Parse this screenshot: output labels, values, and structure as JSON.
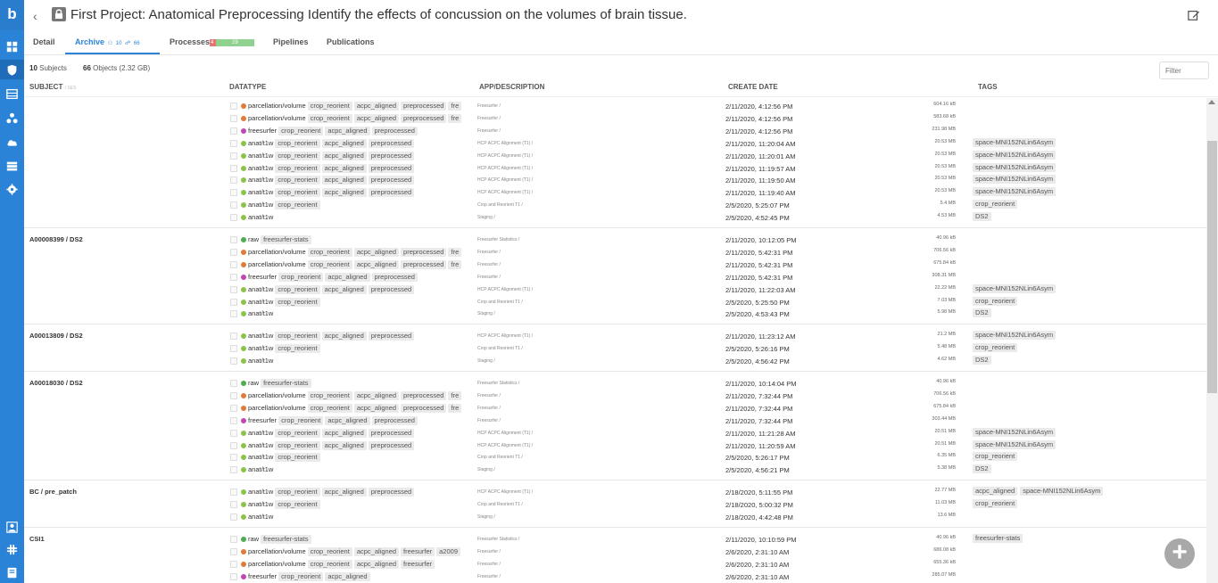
{
  "app": {
    "logo": "b"
  },
  "rail_icons": [
    "dashboard-icon",
    "shield-icon",
    "table-icon",
    "network-icon",
    "cloud-upload-icon",
    "server-icon",
    "gear-icon",
    "user-icon",
    "slack-icon",
    "book-icon"
  ],
  "header": {
    "back": "‹",
    "title": "First Project: Anatomical Preprocessing Identify the effects of concussion on the volumes of brain tissue."
  },
  "tabs": {
    "detail": "Detail",
    "archive": "Archive",
    "archive_users": "10",
    "archive_objects": "66",
    "processes": "Processes",
    "processes_failed": "4",
    "processes_done": "29",
    "pipelines": "Pipelines",
    "publications": "Publications"
  },
  "summary": {
    "subjects_count": "10",
    "subjects_label": "Subjects",
    "objects_count": "66",
    "objects_label": "Objects (2.32 GB)"
  },
  "filter": {
    "placeholder": "Filter"
  },
  "columns": {
    "subject": "SUBJECT",
    "subject_sub": "/ SES",
    "datatype": "DATATYPE",
    "app": "APP/DESCRIPTION",
    "date": "CREATE DATE",
    "tags": "TAGS"
  },
  "colors": {
    "raw": "#4caf50",
    "parcellation": "#e07b39",
    "freesurfer": "#c047b8",
    "anat": "#8bc34a",
    "accent": "#2b83d8"
  },
  "groups": [
    {
      "subject": "",
      "rows": [
        {
          "type": "parcellation/volume",
          "dot": "parcellation",
          "tags": [
            "crop_reorient",
            "acpc_aligned",
            "preprocessed",
            "fre"
          ],
          "app": "Freesurfer /",
          "date": "2/11/2020, 4:12:56 PM",
          "size": "604.16 kB",
          "otags": []
        },
        {
          "type": "parcellation/volume",
          "dot": "parcellation",
          "tags": [
            "crop_reorient",
            "acpc_aligned",
            "preprocessed",
            "fre"
          ],
          "app": "Freesurfer /",
          "date": "2/11/2020, 4:12:56 PM",
          "size": "583.68 kB",
          "otags": []
        },
        {
          "type": "freesurfer",
          "dot": "freesurfer",
          "tags": [
            "crop_reorient",
            "acpc_aligned",
            "preprocessed"
          ],
          "app": "Freesurfer /",
          "date": "2/11/2020, 4:12:56 PM",
          "size": "231.98 MB",
          "otags": []
        },
        {
          "type": "anat/t1w",
          "dot": "anat",
          "tags": [
            "crop_reorient",
            "acpc_aligned",
            "preprocessed"
          ],
          "app": "HCP ACPC Alignment (T1) /",
          "date": "2/11/2020, 11:20:04 AM",
          "size": "20.53 MB",
          "otags": [
            "space-MNI152NLin6Asym"
          ]
        },
        {
          "type": "anat/t1w",
          "dot": "anat",
          "tags": [
            "crop_reorient",
            "acpc_aligned",
            "preprocessed"
          ],
          "app": "HCP ACPC Alignment (T1) /",
          "date": "2/11/2020, 11:20:01 AM",
          "size": "20.53 MB",
          "otags": [
            "space-MNI152NLin6Asym"
          ]
        },
        {
          "type": "anat/t1w",
          "dot": "anat",
          "tags": [
            "crop_reorient",
            "acpc_aligned",
            "preprocessed"
          ],
          "app": "HCP ACPC Alignment (T1) /",
          "date": "2/11/2020, 11:19:57 AM",
          "size": "20.53 MB",
          "otags": [
            "space-MNI152NLin6Asym"
          ]
        },
        {
          "type": "anat/t1w",
          "dot": "anat",
          "tags": [
            "crop_reorient",
            "acpc_aligned",
            "preprocessed"
          ],
          "app": "HCP ACPC Alignment (T1) /",
          "date": "2/11/2020, 11:19:50 AM",
          "size": "20.53 MB",
          "otags": [
            "space-MNI152NLin6Asym"
          ]
        },
        {
          "type": "anat/t1w",
          "dot": "anat",
          "tags": [
            "crop_reorient",
            "acpc_aligned",
            "preprocessed"
          ],
          "app": "HCP ACPC Alignment (T1) /",
          "date": "2/11/2020, 11:19:40 AM",
          "size": "20.53 MB",
          "otags": [
            "space-MNI152NLin6Asym"
          ]
        },
        {
          "type": "anat/t1w",
          "dot": "anat",
          "tags": [
            "crop_reorient"
          ],
          "app": "Crop and Reorient T1 /",
          "date": "2/5/2020, 5:25:07 PM",
          "size": "5.4 MB",
          "otags": [
            "crop_reorient"
          ]
        },
        {
          "type": "anat/t1w",
          "dot": "anat",
          "tags": [],
          "app": "Staging /",
          "date": "2/5/2020, 4:52:45 PM",
          "size": "4.53 MB",
          "otags": [
            "DS2"
          ]
        }
      ]
    },
    {
      "subject": "A00008399 / DS2",
      "rows": [
        {
          "type": "raw",
          "dot": "raw",
          "tags": [
            "freesurfer-stats"
          ],
          "app": "Freesurfer Statistics /",
          "date": "2/11/2020, 10:12:05 PM",
          "size": "40.96 kB",
          "otags": []
        },
        {
          "type": "parcellation/volume",
          "dot": "parcellation",
          "tags": [
            "crop_reorient",
            "acpc_aligned",
            "preprocessed",
            "fre"
          ],
          "app": "Freesurfer /",
          "date": "2/11/2020, 5:42:31 PM",
          "size": "706.56 kB",
          "otags": []
        },
        {
          "type": "parcellation/volume",
          "dot": "parcellation",
          "tags": [
            "crop_reorient",
            "acpc_aligned",
            "preprocessed",
            "fre"
          ],
          "app": "Freesurfer /",
          "date": "2/11/2020, 5:42:31 PM",
          "size": "675.84 kB",
          "otags": []
        },
        {
          "type": "freesurfer",
          "dot": "freesurfer",
          "tags": [
            "crop_reorient",
            "acpc_aligned",
            "preprocessed"
          ],
          "app": "Freesurfer /",
          "date": "2/11/2020, 5:42:31 PM",
          "size": "308.31 MB",
          "otags": []
        },
        {
          "type": "anat/t1w",
          "dot": "anat",
          "tags": [
            "crop_reorient",
            "acpc_aligned",
            "preprocessed"
          ],
          "app": "HCP ACPC Alignment (T1) /",
          "date": "2/11/2020, 11:22:03 AM",
          "size": "22.22 MB",
          "otags": [
            "space-MNI152NLin6Asym"
          ]
        },
        {
          "type": "anat/t1w",
          "dot": "anat",
          "tags": [
            "crop_reorient"
          ],
          "app": "Crop and Reorient T1 /",
          "date": "2/5/2020, 5:25:50 PM",
          "size": "7.03 MB",
          "otags": [
            "crop_reorient"
          ]
        },
        {
          "type": "anat/t1w",
          "dot": "anat",
          "tags": [],
          "app": "Staging /",
          "date": "2/5/2020, 4:53:43 PM",
          "size": "5.98 MB",
          "otags": [
            "DS2"
          ]
        }
      ]
    },
    {
      "subject": "A00013809 / DS2",
      "rows": [
        {
          "type": "anat/t1w",
          "dot": "anat",
          "tags": [
            "crop_reorient",
            "acpc_aligned",
            "preprocessed"
          ],
          "app": "HCP ACPC Alignment (T1) /",
          "date": "2/11/2020, 11:23:12 AM",
          "size": "21.2 MB",
          "otags": [
            "space-MNI152NLin6Asym"
          ]
        },
        {
          "type": "anat/t1w",
          "dot": "anat",
          "tags": [
            "crop_reorient"
          ],
          "app": "Crop and Reorient T1 /",
          "date": "2/5/2020, 5:26:16 PM",
          "size": "5.48 MB",
          "otags": [
            "crop_reorient"
          ]
        },
        {
          "type": "anat/t1w",
          "dot": "anat",
          "tags": [],
          "app": "Staging /",
          "date": "2/5/2020, 4:56:42 PM",
          "size": "4.62 MB",
          "otags": [
            "DS2"
          ]
        }
      ]
    },
    {
      "subject": "A00018030 / DS2",
      "rows": [
        {
          "type": "raw",
          "dot": "raw",
          "tags": [
            "freesurfer-stats"
          ],
          "app": "Freesurfer Statistics /",
          "date": "2/11/2020, 10:14:04 PM",
          "size": "40.96 kB",
          "otags": []
        },
        {
          "type": "parcellation/volume",
          "dot": "parcellation",
          "tags": [
            "crop_reorient",
            "acpc_aligned",
            "preprocessed",
            "fre"
          ],
          "app": "Freesurfer /",
          "date": "2/11/2020, 7:32:44 PM",
          "size": "706.56 kB",
          "otags": []
        },
        {
          "type": "parcellation/volume",
          "dot": "parcellation",
          "tags": [
            "crop_reorient",
            "acpc_aligned",
            "preprocessed",
            "fre"
          ],
          "app": "Freesurfer /",
          "date": "2/11/2020, 7:32:44 PM",
          "size": "675.84 kB",
          "otags": []
        },
        {
          "type": "freesurfer",
          "dot": "freesurfer",
          "tags": [
            "crop_reorient",
            "acpc_aligned",
            "preprocessed"
          ],
          "app": "Freesurfer /",
          "date": "2/11/2020, 7:32:44 PM",
          "size": "303.44 MB",
          "otags": []
        },
        {
          "type": "anat/t1w",
          "dot": "anat",
          "tags": [
            "crop_reorient",
            "acpc_aligned",
            "preprocessed"
          ],
          "app": "HCP ACPC Alignment (T1) /",
          "date": "2/11/2020, 11:21:28 AM",
          "size": "20.51 MB",
          "otags": [
            "space-MNI152NLin6Asym"
          ]
        },
        {
          "type": "anat/t1w",
          "dot": "anat",
          "tags": [
            "crop_reorient",
            "acpc_aligned",
            "preprocessed"
          ],
          "app": "HCP ACPC Alignment (T1) /",
          "date": "2/11/2020, 11:20:59 AM",
          "size": "20.51 MB",
          "otags": [
            "space-MNI152NLin6Asym"
          ]
        },
        {
          "type": "anat/t1w",
          "dot": "anat",
          "tags": [
            "crop_reorient"
          ],
          "app": "Crop and Reorient T1 /",
          "date": "2/5/2020, 5:26:17 PM",
          "size": "6.35 MB",
          "otags": [
            "crop_reorient"
          ]
        },
        {
          "type": "anat/t1w",
          "dot": "anat",
          "tags": [],
          "app": "Staging /",
          "date": "2/5/2020, 4:56:21 PM",
          "size": "5.38 MB",
          "otags": [
            "DS2"
          ]
        }
      ]
    },
    {
      "subject": "BC / pre_patch",
      "rows": [
        {
          "type": "anat/t1w",
          "dot": "anat",
          "tags": [
            "crop_reorient",
            "acpc_aligned",
            "preprocessed"
          ],
          "app": "HCP ACPC Alignment (T1) /",
          "date": "2/18/2020, 5:11:55 PM",
          "size": "22.77 MB",
          "otags": [
            "acpc_aligned",
            "space-MNI152NLin6Asym"
          ]
        },
        {
          "type": "anat/t1w",
          "dot": "anat",
          "tags": [
            "crop_reorient"
          ],
          "app": "Crop and Reorient T1 /",
          "date": "2/18/2020, 5:00:32 PM",
          "size": "11.03 MB",
          "otags": [
            "crop_reorient"
          ]
        },
        {
          "type": "anat/t1w",
          "dot": "anat",
          "tags": [],
          "app": "Staging /",
          "date": "2/18/2020, 4:42:48 PM",
          "size": "13.6 MB",
          "otags": []
        }
      ]
    },
    {
      "subject": "CSI1",
      "rows": [
        {
          "type": "raw",
          "dot": "raw",
          "tags": [
            "freesurfer-stats"
          ],
          "app": "Freesurfer Statistics /",
          "date": "2/11/2020, 10:10:59 PM",
          "size": "40.96 kB",
          "otags": [
            "freesurfer-stats"
          ]
        },
        {
          "type": "parcellation/volume",
          "dot": "parcellation",
          "tags": [
            "crop_reorient",
            "acpc_aligned",
            "freesurfer",
            "a2009"
          ],
          "app": "Freesurfer /",
          "date": "2/6/2020, 2:31:10 AM",
          "size": "686.08 kB",
          "otags": []
        },
        {
          "type": "parcellation/volume",
          "dot": "parcellation",
          "tags": [
            "crop_reorient",
            "acpc_aligned",
            "freesurfer"
          ],
          "app": "Freesurfer /",
          "date": "2/6/2020, 2:31:10 AM",
          "size": "655.36 kB",
          "otags": []
        },
        {
          "type": "freesurfer",
          "dot": "freesurfer",
          "tags": [
            "crop_reorient",
            "acpc_aligned"
          ],
          "app": "Freesurfer /",
          "date": "2/6/2020, 2:31:10 AM",
          "size": "285.07 MB",
          "otags": []
        },
        {
          "type": "anat/t1w",
          "dot": "anat",
          "tags": [
            "crop_reorient",
            "acpc_aligned"
          ],
          "app": "HCP ACPC Alignment (T1) /",
          "date": "2/5/2020, 5:42:28 PM",
          "size": "22.39 MB",
          "otags": []
        }
      ]
    }
  ]
}
